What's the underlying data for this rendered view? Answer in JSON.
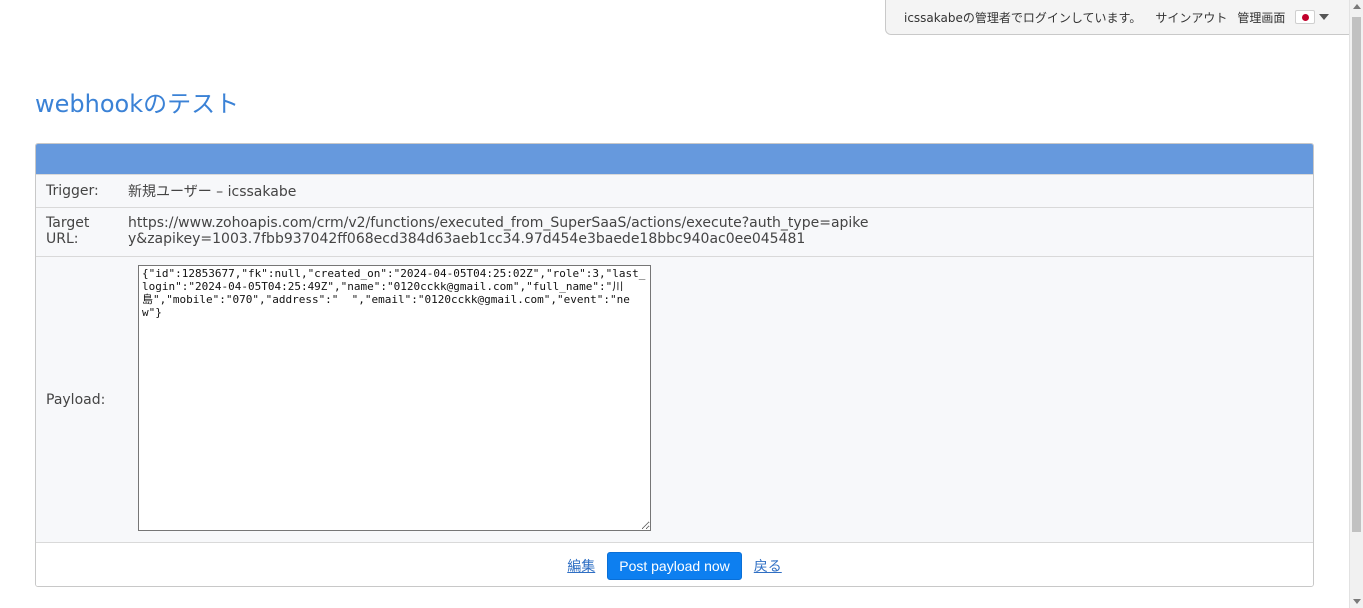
{
  "userbar": {
    "status_text": "icssakabeの管理者でログインしています。",
    "signout_label": "サインアウト",
    "admin_label": "管理画面",
    "language_flag": "japan-flag-icon"
  },
  "page": {
    "title": "webhookのテスト"
  },
  "details": {
    "trigger_label": "Trigger:",
    "trigger_value": "新規ユーザー – icssakabe",
    "url_label": "Target URL:",
    "url_value": "https://www.zohoapis.com/crm/v2/functions/executed_from_SuperSaaS/actions/execute?auth_type=apikey&zapikey=1003.7fbb937042ff068ecd384d63aeb1cc34.97d454e3baede18bbc940ac0ee045481",
    "payload_label": "Payload:",
    "payload_value": "{\"id\":12853677,\"fk\":null,\"created_on\":\"2024-04-05T04:25:02Z\",\"role\":3,\"last_login\":\"2024-04-05T04:25:49Z\",\"name\":\"0120cckk@gmail.com\",\"full_name\":\"川島\",\"mobile\":\"070\",\"address\":\"  \",\"email\":\"0120cckk@gmail.com\",\"event\":\"new\"}"
  },
  "actions": {
    "edit_label": "編集",
    "post_label": "Post payload now",
    "back_label": "戻る"
  },
  "colors": {
    "accent": "#3b82d6",
    "panel_header": "#6699dd",
    "primary_button": "#0d7ff0"
  }
}
